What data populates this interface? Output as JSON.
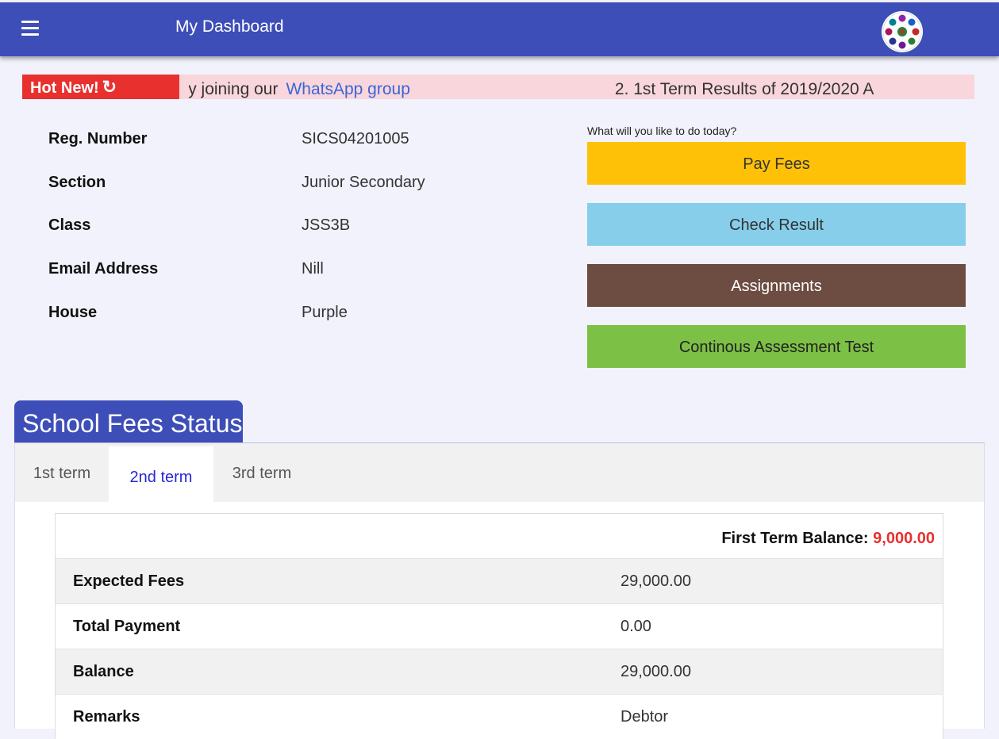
{
  "header": {
    "title": "My Dashboard",
    "menu_icon": "hamburger-menu-icon",
    "logo": "school-logo"
  },
  "ticker": {
    "badge": "Hot New!",
    "badge_icon": "refresh-icon",
    "item1_text": "ormation by joining our",
    "item1_link": "WhatsApp group",
    "item2_text": "2. 1st Term Results of 2019/2020 A"
  },
  "profile": {
    "rows": [
      {
        "label": "Reg. Number",
        "value": "SICS04201005"
      },
      {
        "label": "Section",
        "value": "Junior Secondary"
      },
      {
        "label": "Class",
        "value": "JSS3B"
      },
      {
        "label": "Email Address",
        "value": "Nill"
      },
      {
        "label": "House",
        "value": "Purple"
      }
    ]
  },
  "actions": {
    "prompt": "What will you like to do today?",
    "pay_fees": "Pay Fees",
    "check_result": "Check Result",
    "assignments": "Assignments",
    "cat": "Continous Assessment Test"
  },
  "fees": {
    "heading": "School Fees Status",
    "tabs": [
      "1st term",
      "2nd term",
      "3rd term"
    ],
    "active_tab": "2nd term",
    "balance_label": "First Term Balance:",
    "balance_value": "9,000.00",
    "rows": [
      {
        "label": "Expected Fees",
        "value": "29,000.00"
      },
      {
        "label": "Total Payment",
        "value": "0.00"
      },
      {
        "label": "Balance",
        "value": "29,000.00"
      },
      {
        "label": "Remarks",
        "value": "Debtor"
      }
    ]
  },
  "colors": {
    "header": "#3d4eb8",
    "hot_badge": "#e8312f",
    "pay_fees": "#ffc107",
    "check_result": "#87ceeb",
    "assignments": "#6d4c41",
    "cat": "#7cc045",
    "balance_amount": "#e8312f"
  }
}
